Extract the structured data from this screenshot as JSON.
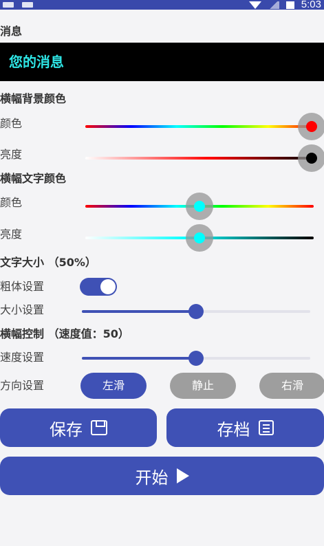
{
  "status_bar": {
    "time": "5:03"
  },
  "message": {
    "section_label": "消息",
    "value": "您的消息"
  },
  "banner_bg": {
    "section_label": "横幅背景颜色",
    "color_label": "颜色",
    "brightness_label": "亮度",
    "color_value": 0.99,
    "brightness_value": 0.99,
    "thumb_color": "#ff0000",
    "brightness_thumb_color": "#000000"
  },
  "banner_text": {
    "section_label": "横幅文字颜色",
    "color_label": "颜色",
    "brightness_label": "亮度",
    "color_value": 0.5,
    "brightness_value": 0.5,
    "thumb_color": "#00ffff"
  },
  "text_size": {
    "section_label": "文字大小 （50%）",
    "bold_label": "粗体设置",
    "bold_enabled": true,
    "size_label": "大小设置",
    "size_value": 0.5
  },
  "banner_control": {
    "section_label": "横幅控制 （速度值：50）",
    "speed_label": "速度设置",
    "speed_value": 0.5,
    "direction_label": "方向设置",
    "directions": [
      "左滑",
      "静止",
      "右滑"
    ],
    "selected_direction": "左滑"
  },
  "actions": {
    "save": "保存",
    "archive": "存档",
    "start": "开始"
  },
  "colors": {
    "accent": "#3f51b5",
    "inactive": "#9e9e9e"
  }
}
